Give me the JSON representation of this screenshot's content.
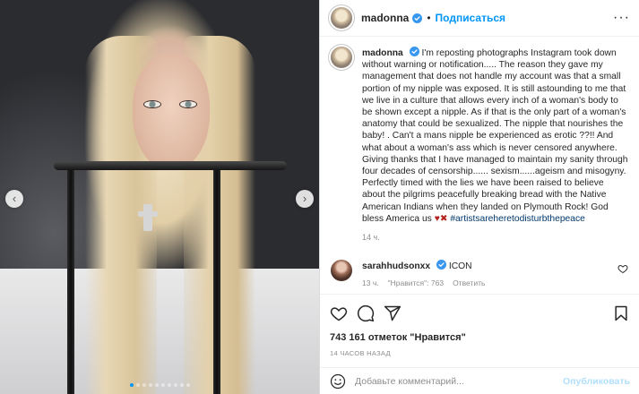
{
  "header": {
    "username": "madonna",
    "separator": "•",
    "follow_label": "Подписаться",
    "more_label": "···"
  },
  "caption": {
    "username": "madonna",
    "text": "I'm reposting photographs Instagram took down without warning or notification..... The reason they gave my management that does not handle my account was that a small portion of my nipple was exposed. It is still astounding to me that we live in a culture that allows every inch of a woman's body to be shown except a nipple. As if that is the only part of a woman's anatomy that could be sexualized. The nipple that nourishes the baby! . Can't a mans nipple be experienced as erotic ??!! And what about a woman's ass which is never censored anywhere. Giving thanks that I have managed to maintain my sanity through four decades of censorship...... sexism......ageism and misogyny. Perfectly timed with the lies we have been raised to believe about the pilgrims peacefully breaking bread with the Native American Indians when they landed on Plymouth Rock! God bless America us ",
    "emoji": "♥✖",
    "hashtag": "#artistsareheretodisturbthepeace",
    "time": "14 ч."
  },
  "reply": {
    "username": "sarahhudsonxx",
    "text": "ICON",
    "time": "13 ч.",
    "likes": "\"Нравится\": 763",
    "reply_label": "Ответить"
  },
  "likes": "743 161 отметок \"Нравится\"",
  "post_time": "14 ЧАСОВ НАЗАД",
  "add_comment": {
    "placeholder": "Добавьте комментарий...",
    "publish_label": "Опубликовать"
  },
  "carousel": {
    "prev_label": "‹",
    "next_label": "›",
    "slide_count": 10,
    "active_index": 0
  },
  "colors": {
    "accent": "#0095f6",
    "hashtag": "#00376b",
    "muted": "#8e8e8e",
    "publish_disabled": "#b2dffc"
  },
  "icons": [
    "verified-icon",
    "heart-icon",
    "comment-icon",
    "share-icon",
    "bookmark-icon",
    "emoji-icon",
    "small-heart-icon"
  ]
}
